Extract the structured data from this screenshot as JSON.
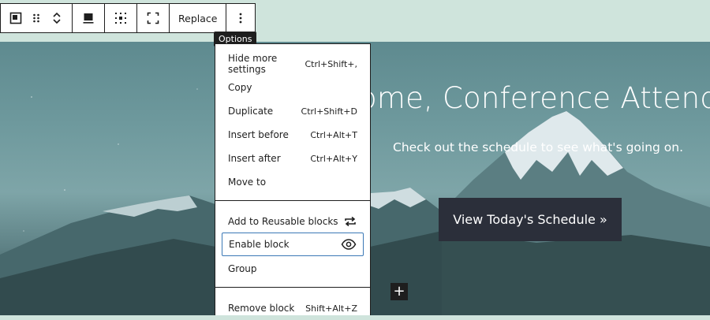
{
  "toolbar": {
    "parent_icon": "block-parent-icon",
    "drag_icon": "drag-handle-icon",
    "move_up_icon": "chevron-up-icon",
    "move_down_icon": "chevron-down-icon",
    "align_icon": "align-icon",
    "position_icon": "content-position-icon",
    "fullheight_icon": "full-height-icon",
    "replace_label": "Replace",
    "options_icon": "more-vertical-icon"
  },
  "tooltip": {
    "text": "Options"
  },
  "menu": {
    "items": [
      {
        "label": "Hide more settings",
        "shortcut": "Ctrl+Shift+,"
      },
      {
        "label": "Copy",
        "shortcut": ""
      },
      {
        "label": "Duplicate",
        "shortcut": "Ctrl+Shift+D"
      },
      {
        "label": "Insert before",
        "shortcut": "Ctrl+Alt+T"
      },
      {
        "label": "Insert after",
        "shortcut": "Ctrl+Alt+Y"
      },
      {
        "label": "Move to",
        "shortcut": ""
      },
      {
        "label": "Add to Reusable blocks",
        "icon": "reusable-block-icon"
      },
      {
        "label": "Enable block",
        "icon": "eye-icon"
      },
      {
        "label": "Group"
      },
      {
        "label": "Remove block",
        "shortcut": "Shift+Alt+Z"
      }
    ]
  },
  "hero": {
    "title": "ome, Conference Attende",
    "subtitle": "Check out the schedule to see what's going on.",
    "button": "View Today's Schedule »"
  },
  "inserter": {
    "symbol": "+",
    "icon": "plus-icon"
  },
  "colors": {
    "toolbar_border": "#1e1e1e",
    "focus": "#3b78b6",
    "button_bg": "#2b2f3a",
    "page_bg": "#cfe4dc"
  }
}
